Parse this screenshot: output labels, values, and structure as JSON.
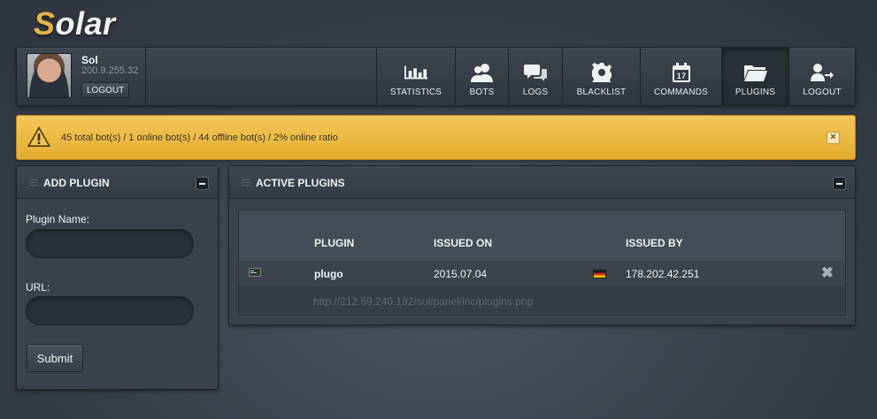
{
  "app": {
    "logo_first": "S",
    "logo_rest": "olar"
  },
  "user": {
    "name": "Sol",
    "ip": "200.9.255.32",
    "logout_label": "LOGOUT"
  },
  "nav": [
    {
      "label": "STATISTICS",
      "icon": "bar-chart-icon"
    },
    {
      "label": "BOTS",
      "icon": "users-icon"
    },
    {
      "label": "LOGS",
      "icon": "chat-bubbles-icon"
    },
    {
      "label": "BLACKLIST",
      "icon": "gear-icon"
    },
    {
      "label": "COMMANDS",
      "icon": "calendar-icon",
      "icon_text": "17"
    },
    {
      "label": "PLUGINS",
      "icon": "folder-icon",
      "active": true
    },
    {
      "label": "LOGOUT",
      "icon": "user-logout-icon"
    }
  ],
  "alert": {
    "text": "45 total bot(s) / 1 online bot(s) / 44 offline bot(s) / 2% online ratio",
    "close_symbol": "×",
    "color": "#f0bd4c"
  },
  "add_plugin": {
    "title": "ADD PLUGIN",
    "name_label": "Plugin Name:",
    "name_value": "",
    "url_label": "URL:",
    "url_value": "",
    "submit_label": "Submit"
  },
  "active_plugins": {
    "title": "ACTIVE PLUGINS",
    "columns": [
      "PLUGIN",
      "ISSUED ON",
      "ISSUED BY"
    ],
    "rows": [
      {
        "plugin": "plugo",
        "issued_on": "2015.07.04",
        "flag": "germany-flag",
        "issued_by": "178.202.42.251",
        "remove_symbol": "✖",
        "url": "http://212.59.240.192/sol/panel/inc/plugins.php"
      }
    ]
  }
}
